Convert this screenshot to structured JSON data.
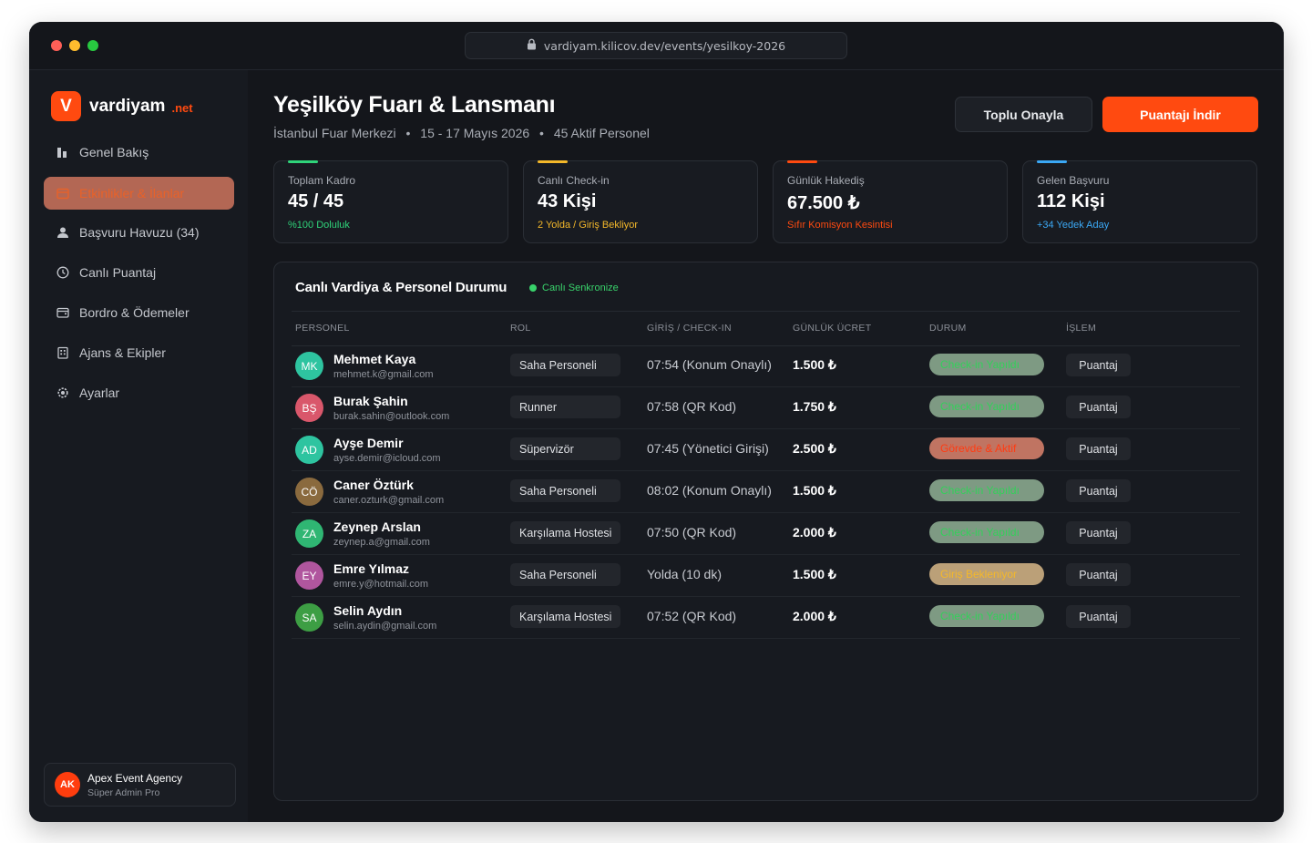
{
  "browser": {
    "url": "vardiyam.kilicov.dev/events/yesilkoy-2026",
    "dots": [
      "#ff5f57",
      "#febc2e",
      "#28c840"
    ]
  },
  "brand": {
    "mark": "V",
    "name": "vardiyam",
    "tld": ".net",
    "accent": "#ff4a10"
  },
  "sidebar": {
    "items": [
      {
        "label": "Genel Bakış",
        "icon": "bar-chart-icon"
      },
      {
        "label": "Etkinlikler & İlanlar",
        "icon": "calendar-icon",
        "active": true
      },
      {
        "label": "Başvuru Havuzu (34)",
        "icon": "user-icon"
      },
      {
        "label": "Canlı Puantaj",
        "icon": "clock-icon"
      },
      {
        "label": "Bordro & Ödemeler",
        "icon": "wallet-icon"
      },
      {
        "label": "Ajans & Ekipler",
        "icon": "building-icon"
      },
      {
        "label": "Ayarlar",
        "icon": "gear-icon"
      }
    ],
    "user": {
      "initials": "AK",
      "name": "Apex Event Agency",
      "role": "Süper Admin Pro"
    }
  },
  "header": {
    "title": "Yeşilköy Fuarı & Lansmanı",
    "venue": "İstanbul Fuar Merkezi",
    "dates": "15 - 17 Mayıs 2026",
    "staff": "45 Aktif Personel",
    "sep": "•",
    "approve_label": "Toplu Onayla",
    "download_label": "Puantajı İndir"
  },
  "stats": [
    {
      "label": "Toplam Kadro",
      "value": "45 / 45",
      "sub": "%100 Doluluk",
      "color": "#2fd47a"
    },
    {
      "label": "Canlı Check-in",
      "value": "43 Kişi",
      "sub": "2 Yolda / Giriş Bekliyor",
      "color": "#f4b82a"
    },
    {
      "label": "Günlük Hakediş",
      "value": "67.500 ₺",
      "sub": "Sıfır Komisyon Kesintisi",
      "color": "#ff4a10"
    },
    {
      "label": "Gelen Başvuru",
      "value": "112 Kişi",
      "sub": "+34 Yedek Aday",
      "color": "#3ba8f5"
    }
  ],
  "panel": {
    "title": "Canlı Vardiya & Personel Durumu",
    "sync_label": "Canlı Senkronize",
    "columns": [
      "PERSONEL",
      "ROL",
      "GİRİŞ / CHECK-IN",
      "GÜNLÜK ÜCRET",
      "DURUM",
      "İŞLEM"
    ],
    "rows": [
      {
        "initials": "MK",
        "avatar_color": "#2ec4a0",
        "name": "Mehmet Kaya",
        "email": "mehmet.k@gmail.com",
        "role": "Saha Personeli",
        "checkin": "07:54 (Konum Onaylı)",
        "fee": "1.500 ₺",
        "status": "Check-in Yapıldı",
        "status_type": "ok",
        "action": "Puantaj"
      },
      {
        "initials": "BŞ",
        "avatar_color": "#d9576b",
        "name": "Burak Şahin",
        "email": "burak.sahin@outlook.com",
        "role": "Runner",
        "checkin": "07:58 (QR Kod)",
        "fee": "1.750 ₺",
        "status": "Check-in Yapıldı",
        "status_type": "ok",
        "action": "Puantaj"
      },
      {
        "initials": "AD",
        "avatar_color": "#2ec4a0",
        "name": "Ayşe Demir",
        "email": "ayse.demir@icloud.com",
        "role": "Süpervizör",
        "checkin": "07:45 (Yönetici Girişi)",
        "fee": "2.500 ₺",
        "status": "Görevde & Aktif",
        "status_type": "active",
        "action": "Puantaj"
      },
      {
        "initials": "CÖ",
        "avatar_color": "#8a6a3e",
        "name": "Caner Öztürk",
        "email": "caner.ozturk@gmail.com",
        "role": "Saha Personeli",
        "checkin": "08:02 (Konum Onaylı)",
        "fee": "1.500 ₺",
        "status": "Check-in Yapıldı",
        "status_type": "ok",
        "action": "Puantaj"
      },
      {
        "initials": "ZA",
        "avatar_color": "#2fb673",
        "name": "Zeynep Arslan",
        "email": "zeynep.a@gmail.com",
        "role": "Karşılama Hostesi",
        "checkin": "07:50 (QR Kod)",
        "fee": "2.000 ₺",
        "status": "Check-in Yapıldı",
        "status_type": "ok",
        "action": "Puantaj"
      },
      {
        "initials": "EY",
        "avatar_color": "#b0569e",
        "name": "Emre Yılmaz",
        "email": "emre.y@hotmail.com",
        "role": "Saha Personeli",
        "checkin": "Yolda (10 dk)",
        "fee": "1.500 ₺",
        "status": "Giriş Bekleniyor",
        "status_type": "wait",
        "action": "Puantaj"
      },
      {
        "initials": "SA",
        "avatar_color": "#3d9e44",
        "name": "Selin Aydın",
        "email": "selin.aydin@gmail.com",
        "role": "Karşılama Hostesi",
        "checkin": "07:52 (QR Kod)",
        "fee": "2.000 ₺",
        "status": "Check-in Yapıldı",
        "status_type": "ok",
        "action": "Puantaj"
      }
    ]
  },
  "status_colors": {
    "ok": {
      "bg": "#7e9a83",
      "fg": "#33d05a"
    },
    "active": {
      "bg": "#c07462",
      "fg": "#ff3b12"
    },
    "wait": {
      "bg": "#bba078",
      "fg": "#f4b82a"
    }
  }
}
